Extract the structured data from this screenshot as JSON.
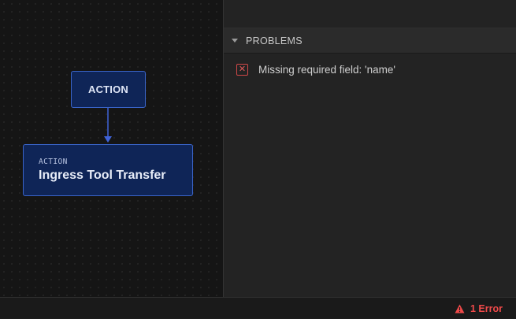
{
  "canvas": {
    "nodes": [
      {
        "label": "ACTION"
      },
      {
        "subtitle": "ACTION",
        "title": "Ingress Tool Transfer"
      }
    ]
  },
  "problems": {
    "header": "PROBLEMS",
    "items": [
      {
        "icon": "error-icon",
        "message": "Missing required field: 'name'"
      }
    ]
  },
  "status": {
    "errors_label": "1 Error",
    "icon": "warning-icon"
  },
  "colors": {
    "node_fill": "#0f2557",
    "node_border": "#3a64c8",
    "connector": "#3f63d8",
    "error": "#f04a4a"
  }
}
